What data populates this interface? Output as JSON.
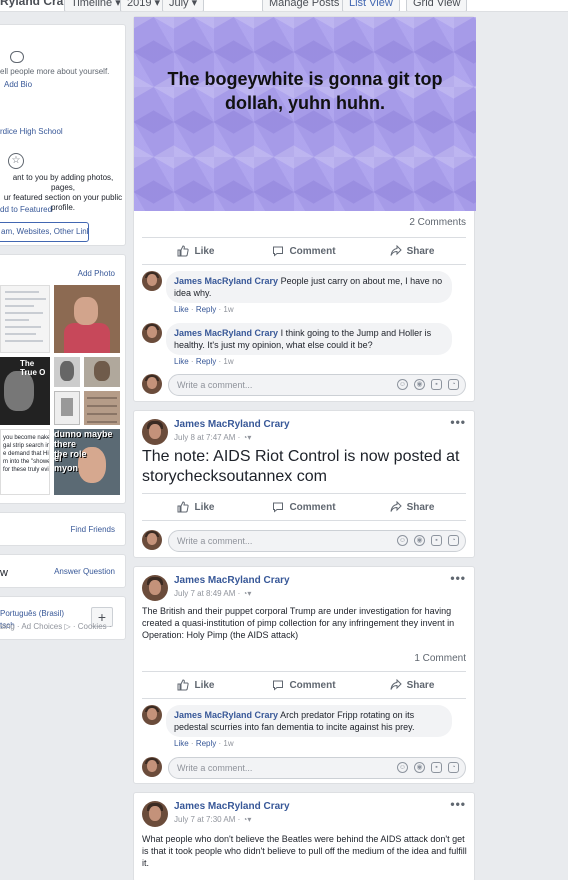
{
  "topbar": {
    "name": "Ryland Crary",
    "timeline": "Timeline ▾",
    "year": "2019 ▾",
    "month": "July ▾",
    "manage_posts": "Manage Posts",
    "list_view": "List View",
    "grid_view": "Grid View"
  },
  "intro": {
    "bio_prompt": "ell people more about yourself.",
    "add_bio": "Add Bio",
    "school": "rdice High School",
    "featured_text": "ant to you by adding photos, pages,\nur featured section on your public\nprofile.",
    "add_featured": "dd to Featured",
    "links_button": "am, Websites, Other Links"
  },
  "photos": {
    "add_photo": "Add Photo",
    "thumb_text_1": "The True O",
    "thumb_text_meme": "dunno maybe there\nthe role",
    "thumb_text_meme2": "el\nmyon",
    "thumb_text_doc": "you become naked\ngal strip search in h\ne demand that Hitle\nm into the \"showers\nfor these truly evil p"
  },
  "friends": {
    "find_friends": "Find Friends"
  },
  "qa": {
    "label": "w",
    "answer_question": "Answer Question"
  },
  "languages": {
    "line1": "Português (Brasil)",
    "line2": "tsch",
    "plus": "+"
  },
  "footer": {
    "text": "sing · Ad Choices ▷ · Cookies ·"
  },
  "post1": {
    "background_text": "The bogeywhite is gonna git top dollah, yuhn huhn.",
    "comment_count": "2 Comments",
    "comments": [
      {
        "author": "James MacRyland Crary",
        "text": "People just carry on about me, I have no idea why.",
        "like": "Like",
        "reply": "Reply",
        "time": "1w"
      },
      {
        "author": "James MacRyland Crary",
        "text": "I think going to the Jump and Holler is healthy. It's just my opinion, what else could it be?",
        "like": "Like",
        "reply": "Reply",
        "time": "1w"
      }
    ]
  },
  "actions": {
    "like": "Like",
    "comment": "Comment",
    "share": "Share"
  },
  "write_placeholder": "Write a comment...",
  "post2": {
    "author": "James MacRyland Crary",
    "date": "July 8 at 7:47 AM · ",
    "body": "The note: AIDS Riot Control is now posted at storychecksoutannex com"
  },
  "post3": {
    "author": "James MacRyland Crary",
    "date": "July 7 at 8:49 AM · ",
    "body": "The British and their puppet corporal Trump are under investigation for having created a quasi-institution of pimp collection for any infringement they invent in Operation: Holy Pimp (the AIDS attack)",
    "comment_count": "1 Comment",
    "comment": {
      "author": "James MacRyland Crary",
      "text": "Arch predator Fripp rotating on its pedestal scurries into fan dementia to incite against his prey.",
      "like": "Like",
      "reply": "Reply",
      "time": "1w"
    }
  },
  "post4": {
    "author": "James MacRyland Crary",
    "date": "July 7 at 7:30 AM · ",
    "body": "What people who don't believe the Beatles were behind the AIDS attack don't get is that it took people who didn't believe to pull off the medium of the idea and fulfill it."
  },
  "icons": {
    "like": "thumbs-up-icon",
    "comment": "speech-bubble-icon",
    "share": "share-arrow-icon",
    "globe": "globe-icon",
    "more": "ellipsis-icon"
  },
  "colors": {
    "link": "#385898",
    "page_bg": "#e9ebee",
    "post_bg": "#a69be8"
  }
}
